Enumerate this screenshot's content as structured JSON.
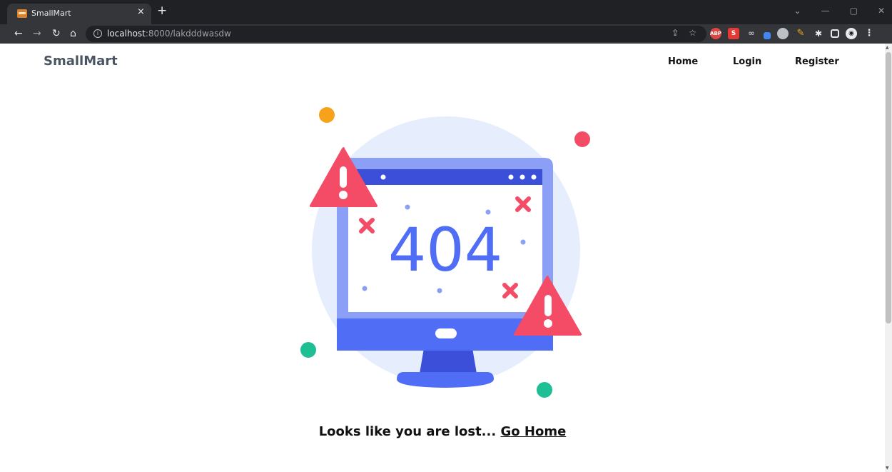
{
  "browser": {
    "tab_title": "SmallMart",
    "tab_close": "×",
    "new_tab": "+",
    "url_host": "localhost",
    "url_path": ":8000/lakdddwasdw",
    "controls": {
      "minimize": "—",
      "restore": "▢",
      "close": "✕",
      "chevron": "⌄"
    },
    "extensions": [
      "ABP",
      "S"
    ]
  },
  "site": {
    "brand": "SmallMart",
    "nav": {
      "home": "Home",
      "login": "Login",
      "register": "Register"
    }
  },
  "error": {
    "code": "404",
    "message": "Looks like you are lost...",
    "link": "Go Home"
  },
  "colors": {
    "accent_blue": "#4f6df5",
    "warning_red": "#f44c66",
    "dot_orange": "#f7a21b",
    "dot_teal": "#1fbf96",
    "circle_bg": "#e6edfc"
  }
}
